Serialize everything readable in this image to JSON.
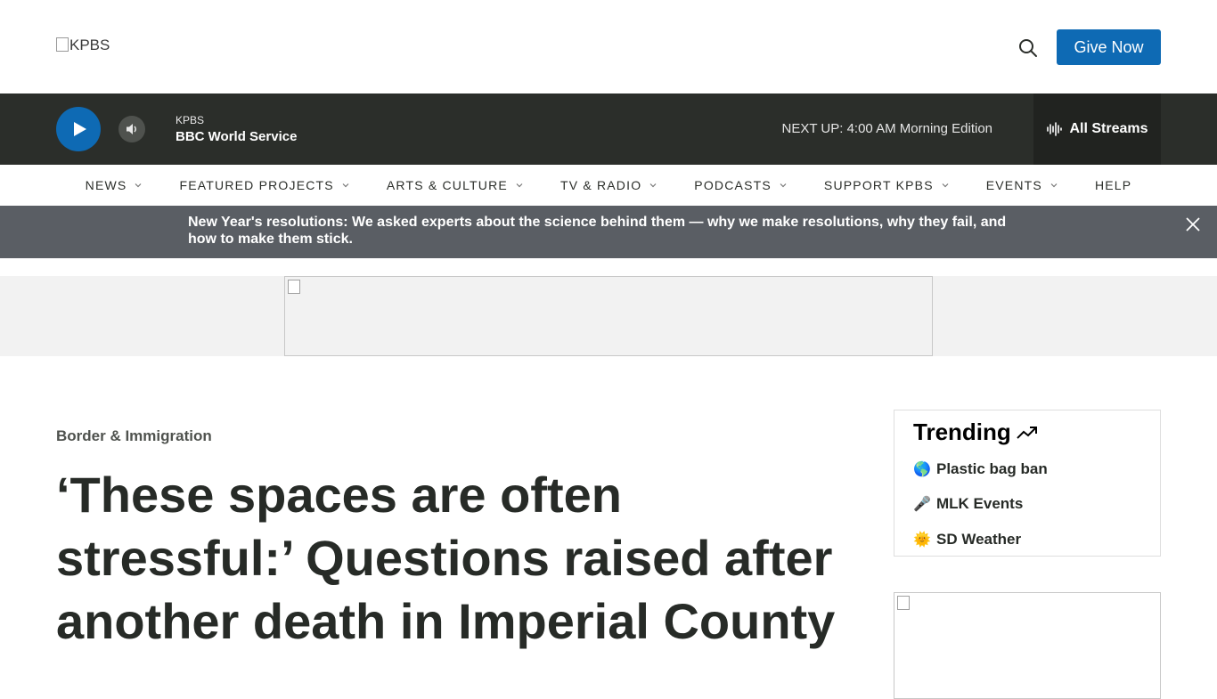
{
  "header": {
    "logo_alt": "KPBS",
    "give_label": "Give Now",
    "colors": {
      "brand_blue": "#0e6ab4"
    }
  },
  "player": {
    "station": "KPBS",
    "program": "BBC World Service",
    "next_up": "NEXT UP: 4:00 AM Morning Edition",
    "all_streams_label": "All Streams",
    "colors": {
      "bar": "#2b2e2a",
      "play": "#0e6ab4"
    }
  },
  "nav": {
    "items": [
      {
        "label": "NEWS"
      },
      {
        "label": "FEATURED PROJECTS"
      },
      {
        "label": "ARTS & CULTURE"
      },
      {
        "label": "TV & RADIO"
      },
      {
        "label": "PODCASTS"
      },
      {
        "label": "SUPPORT KPBS"
      },
      {
        "label": "EVENTS"
      },
      {
        "label": "HELP"
      }
    ]
  },
  "alert": {
    "text": "New Year's resolutions: We asked experts about the science behind them — why we make resolutions, why they fail, and how to make them stick."
  },
  "article": {
    "category": "Border & Immigration",
    "headline": "‘These spaces are often stressful:’ Questions raised after another death in Imperial County"
  },
  "trending": {
    "title": "Trending",
    "items": [
      {
        "emoji": "🌎",
        "label": "Plastic bag ban"
      },
      {
        "emoji": "🎤",
        "label": "MLK Events"
      },
      {
        "emoji": "🌞",
        "label": "SD Weather"
      }
    ]
  }
}
